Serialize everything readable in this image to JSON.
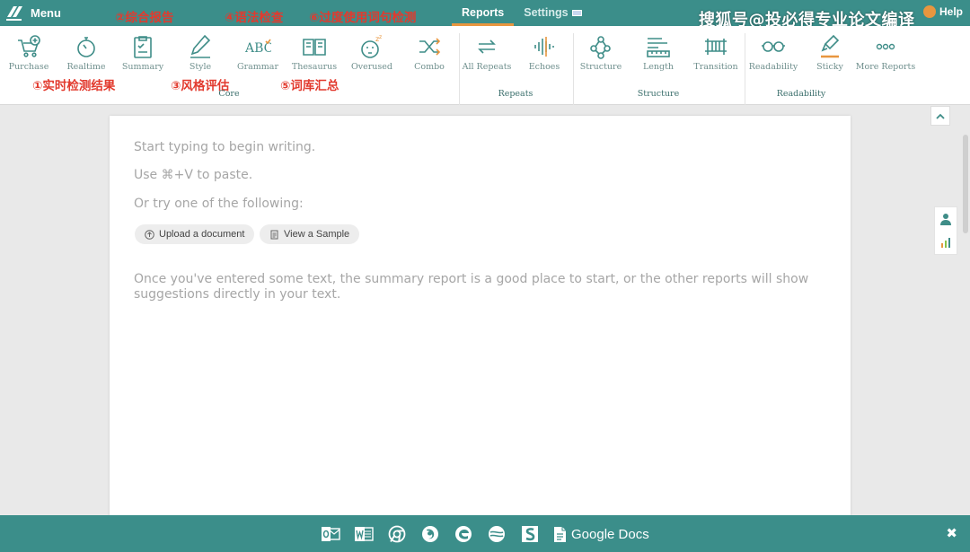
{
  "topbar": {
    "menu_label": "Menu",
    "tabs": [
      {
        "label": "Reports",
        "active": true
      },
      {
        "label": "Settings",
        "active": false
      }
    ],
    "help_label": "Help",
    "watermark": "搜狐号@投必得专业论文编译",
    "annotations_top": [
      "②综合报告",
      "④语法检查",
      "⑥过度使用词句检测"
    ]
  },
  "ribbon": {
    "tools": [
      {
        "label": "Purchase",
        "icon": "cart-icon"
      },
      {
        "label": "Realtime",
        "icon": "stopwatch-icon"
      },
      {
        "label": "Summary",
        "icon": "clipboard-icon"
      },
      {
        "label": "Style",
        "icon": "pen-icon"
      },
      {
        "label": "Grammar",
        "icon": "abc-icon"
      },
      {
        "label": "Thesaurus",
        "icon": "book-icon"
      },
      {
        "label": "Overused",
        "icon": "sleepy-face-icon"
      },
      {
        "label": "Combo",
        "icon": "shuffle-icon"
      },
      {
        "label": "All Repeats",
        "icon": "repeat-icon"
      },
      {
        "label": "Echoes",
        "icon": "soundwave-icon"
      },
      {
        "label": "Structure",
        "icon": "network-icon"
      },
      {
        "label": "Length",
        "icon": "ruler-icon"
      },
      {
        "label": "Transition",
        "icon": "bridge-icon"
      },
      {
        "label": "Readability",
        "icon": "glasses-icon"
      },
      {
        "label": "Sticky",
        "icon": "highlighter-icon"
      },
      {
        "label": "More Reports",
        "icon": "dots-icon"
      }
    ],
    "groups": [
      "Core",
      "Repeats",
      "Structure",
      "Readability"
    ],
    "annotations_ribbon": [
      "①实时检测结果",
      "③风格评估",
      "⑤词库汇总"
    ]
  },
  "editor": {
    "line1": "Start typing to begin writing.",
    "line2": "Use ⌘+V to paste.",
    "line3": "Or try one of the following:",
    "upload_label": "Upload a document",
    "sample_label": "View a Sample",
    "hint": "Once you've entered some text, the summary report is a good place to start, or the other reports will show suggestions directly in your text."
  },
  "bottombar": {
    "icons": [
      "outlook-icon",
      "word-icon",
      "chrome-icon",
      "firefox-icon",
      "edge-icon",
      "safari-icon",
      "scrivener-icon"
    ],
    "google_docs_label": "Google Docs"
  },
  "colors": {
    "teal": "#3b8e8a",
    "accent": "#e8963f",
    "annotation": "#e23a2e",
    "icon": "#3f8d88"
  }
}
